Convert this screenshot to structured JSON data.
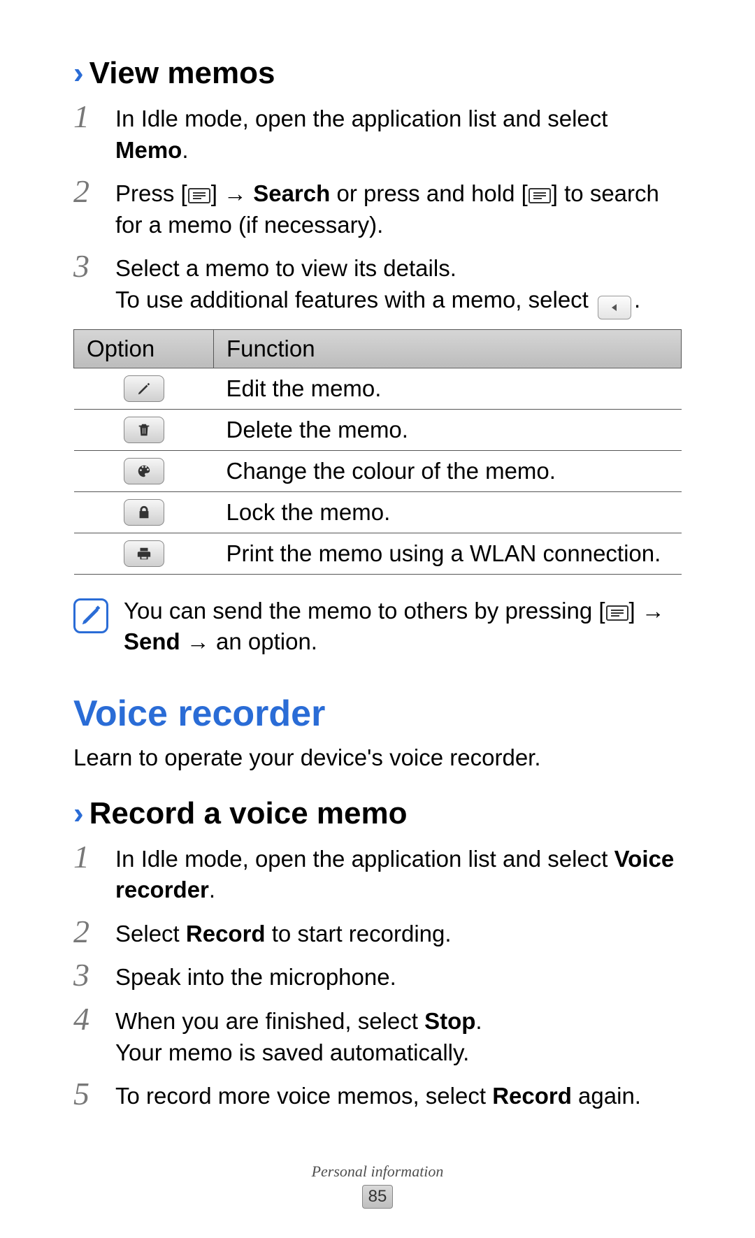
{
  "section1": {
    "title": "View memos",
    "steps": [
      {
        "num": "1",
        "pre": "In Idle mode, open the application list and select ",
        "bold": "Memo",
        "post": "."
      },
      {
        "num": "2",
        "pre": "Press [",
        "mid1": "] ",
        "arrow1": "→",
        "bold": " Search",
        "mid2": " or press and hold [",
        "post": "] to search for a memo (if necessary)."
      },
      {
        "num": "3",
        "line1": "Select a memo to view its details.",
        "line2": "To use additional features with a memo, select ",
        "line2post": "."
      }
    ],
    "table": {
      "h1": "Option",
      "h2": "Function",
      "rows": [
        {
          "icon": "pencil-icon",
          "func": "Edit the memo."
        },
        {
          "icon": "trash-icon",
          "func": "Delete the memo."
        },
        {
          "icon": "palette-icon",
          "func": "Change the colour of the memo."
        },
        {
          "icon": "lock-icon",
          "func": "Lock the memo."
        },
        {
          "icon": "printer-icon",
          "func": "Print the memo using a WLAN connection."
        }
      ]
    },
    "note": {
      "pre": "You can send the memo to others by pressing [",
      "post1": "] ",
      "arrow": "→ ",
      "bold": "Send",
      "post2": " → an option."
    }
  },
  "section2": {
    "heading": "Voice recorder",
    "intro": "Learn to operate your device's voice recorder.",
    "subtitle": "Record a voice memo",
    "steps": [
      {
        "num": "1",
        "pre": "In Idle mode, open the application list and select ",
        "bold": "Voice recorder",
        "post": "."
      },
      {
        "num": "2",
        "pre": "Select ",
        "bold": "Record",
        "post": " to start recording."
      },
      {
        "num": "3",
        "pre": "Speak into the microphone."
      },
      {
        "num": "4",
        "pre": "When you are finished, select ",
        "bold": "Stop",
        "post": ".",
        "line2": "Your memo is saved automatically."
      },
      {
        "num": "5",
        "pre": "To record more voice memos, select ",
        "bold": "Record",
        "post": " again."
      }
    ]
  },
  "footer": {
    "label": "Personal information",
    "page": "85"
  }
}
